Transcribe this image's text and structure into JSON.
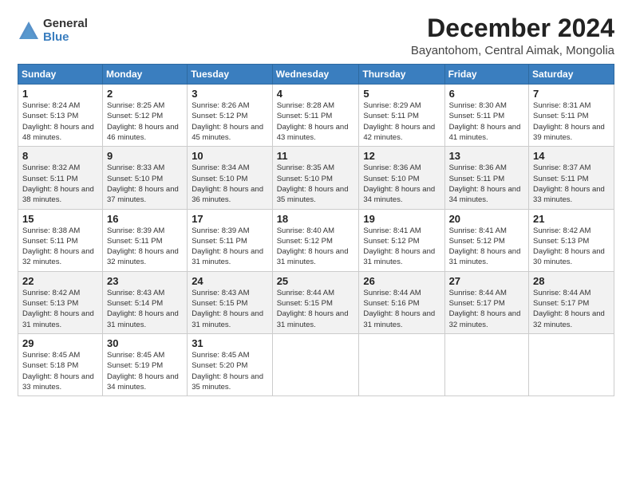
{
  "logo": {
    "general": "General",
    "blue": "Blue"
  },
  "header": {
    "month": "December 2024",
    "location": "Bayantohom, Central Aimak, Mongolia"
  },
  "weekdays": [
    "Sunday",
    "Monday",
    "Tuesday",
    "Wednesday",
    "Thursday",
    "Friday",
    "Saturday"
  ],
  "weeks": [
    [
      {
        "day": "1",
        "sunrise": "8:24 AM",
        "sunset": "5:13 PM",
        "daylight": "8 hours and 48 minutes."
      },
      {
        "day": "2",
        "sunrise": "8:25 AM",
        "sunset": "5:12 PM",
        "daylight": "8 hours and 46 minutes."
      },
      {
        "day": "3",
        "sunrise": "8:26 AM",
        "sunset": "5:12 PM",
        "daylight": "8 hours and 45 minutes."
      },
      {
        "day": "4",
        "sunrise": "8:28 AM",
        "sunset": "5:11 PM",
        "daylight": "8 hours and 43 minutes."
      },
      {
        "day": "5",
        "sunrise": "8:29 AM",
        "sunset": "5:11 PM",
        "daylight": "8 hours and 42 minutes."
      },
      {
        "day": "6",
        "sunrise": "8:30 AM",
        "sunset": "5:11 PM",
        "daylight": "8 hours and 41 minutes."
      },
      {
        "day": "7",
        "sunrise": "8:31 AM",
        "sunset": "5:11 PM",
        "daylight": "8 hours and 39 minutes."
      }
    ],
    [
      {
        "day": "8",
        "sunrise": "8:32 AM",
        "sunset": "5:11 PM",
        "daylight": "8 hours and 38 minutes."
      },
      {
        "day": "9",
        "sunrise": "8:33 AM",
        "sunset": "5:10 PM",
        "daylight": "8 hours and 37 minutes."
      },
      {
        "day": "10",
        "sunrise": "8:34 AM",
        "sunset": "5:10 PM",
        "daylight": "8 hours and 36 minutes."
      },
      {
        "day": "11",
        "sunrise": "8:35 AM",
        "sunset": "5:10 PM",
        "daylight": "8 hours and 35 minutes."
      },
      {
        "day": "12",
        "sunrise": "8:36 AM",
        "sunset": "5:10 PM",
        "daylight": "8 hours and 34 minutes."
      },
      {
        "day": "13",
        "sunrise": "8:36 AM",
        "sunset": "5:11 PM",
        "daylight": "8 hours and 34 minutes."
      },
      {
        "day": "14",
        "sunrise": "8:37 AM",
        "sunset": "5:11 PM",
        "daylight": "8 hours and 33 minutes."
      }
    ],
    [
      {
        "day": "15",
        "sunrise": "8:38 AM",
        "sunset": "5:11 PM",
        "daylight": "8 hours and 32 minutes."
      },
      {
        "day": "16",
        "sunrise": "8:39 AM",
        "sunset": "5:11 PM",
        "daylight": "8 hours and 32 minutes."
      },
      {
        "day": "17",
        "sunrise": "8:39 AM",
        "sunset": "5:11 PM",
        "daylight": "8 hours and 31 minutes."
      },
      {
        "day": "18",
        "sunrise": "8:40 AM",
        "sunset": "5:12 PM",
        "daylight": "8 hours and 31 minutes."
      },
      {
        "day": "19",
        "sunrise": "8:41 AM",
        "sunset": "5:12 PM",
        "daylight": "8 hours and 31 minutes."
      },
      {
        "day": "20",
        "sunrise": "8:41 AM",
        "sunset": "5:12 PM",
        "daylight": "8 hours and 31 minutes."
      },
      {
        "day": "21",
        "sunrise": "8:42 AM",
        "sunset": "5:13 PM",
        "daylight": "8 hours and 30 minutes."
      }
    ],
    [
      {
        "day": "22",
        "sunrise": "8:42 AM",
        "sunset": "5:13 PM",
        "daylight": "8 hours and 31 minutes."
      },
      {
        "day": "23",
        "sunrise": "8:43 AM",
        "sunset": "5:14 PM",
        "daylight": "8 hours and 31 minutes."
      },
      {
        "day": "24",
        "sunrise": "8:43 AM",
        "sunset": "5:15 PM",
        "daylight": "8 hours and 31 minutes."
      },
      {
        "day": "25",
        "sunrise": "8:44 AM",
        "sunset": "5:15 PM",
        "daylight": "8 hours and 31 minutes."
      },
      {
        "day": "26",
        "sunrise": "8:44 AM",
        "sunset": "5:16 PM",
        "daylight": "8 hours and 31 minutes."
      },
      {
        "day": "27",
        "sunrise": "8:44 AM",
        "sunset": "5:17 PM",
        "daylight": "8 hours and 32 minutes."
      },
      {
        "day": "28",
        "sunrise": "8:44 AM",
        "sunset": "5:17 PM",
        "daylight": "8 hours and 32 minutes."
      }
    ],
    [
      {
        "day": "29",
        "sunrise": "8:45 AM",
        "sunset": "5:18 PM",
        "daylight": "8 hours and 33 minutes."
      },
      {
        "day": "30",
        "sunrise": "8:45 AM",
        "sunset": "5:19 PM",
        "daylight": "8 hours and 34 minutes."
      },
      {
        "day": "31",
        "sunrise": "8:45 AM",
        "sunset": "5:20 PM",
        "daylight": "8 hours and 35 minutes."
      },
      null,
      null,
      null,
      null
    ]
  ],
  "labels": {
    "sunrise": "Sunrise: ",
    "sunset": "Sunset: ",
    "daylight": "Daylight: "
  }
}
